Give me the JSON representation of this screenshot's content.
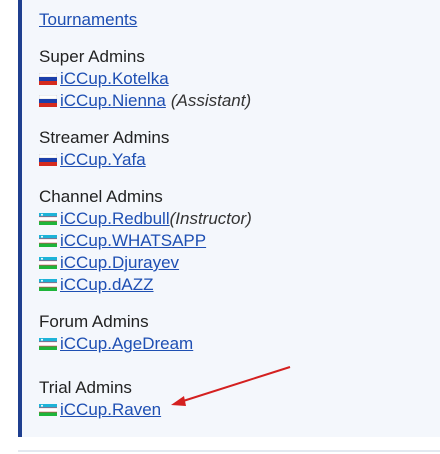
{
  "top_link": "Tournaments",
  "sections": {
    "super_admins": {
      "title": "Super Admins",
      "members": [
        {
          "name": "iCCup.Kotelka",
          "flag": "russia-flag"
        },
        {
          "name": "iCCup.Nienna",
          "flag": "russia-flag",
          "note": "(Assistant)"
        }
      ]
    },
    "streamer_admins": {
      "title": "Streamer Admins",
      "members": [
        {
          "name": "iCCup.Yafa",
          "flag": "russia-flag"
        }
      ]
    },
    "channel_admins": {
      "title": "Channel Admins",
      "members": [
        {
          "name": "iCCup.Redbull",
          "flag": "uzbekistan-flag",
          "note": "(Instructor)"
        },
        {
          "name": "iCCup.WHATSAPP",
          "flag": "uzbekistan-flag"
        },
        {
          "name": "iCCup.Djurayev",
          "flag": "uzbekistan-flag"
        },
        {
          "name": "iCCup.dAZZ",
          "flag": "uzbekistan-flag"
        }
      ]
    },
    "forum_admins": {
      "title": "Forum Admins",
      "members": [
        {
          "name": "iCCup.AgeDream",
          "flag": "uzbekistan-flag"
        }
      ]
    },
    "trial_admins": {
      "title": "Trial Admins",
      "members": [
        {
          "name": "iCCup.Raven",
          "flag": "uzbekistan-flag"
        }
      ]
    }
  },
  "colors": {
    "link": "#1e4fb3",
    "panel_background": "#f4f7fc",
    "panel_border": "#1f3f8f",
    "annotation_arrow": "#d42020"
  }
}
